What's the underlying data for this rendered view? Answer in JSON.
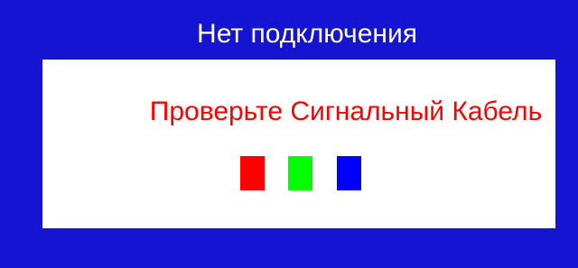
{
  "osd": {
    "title": "Нет подключения",
    "message": "Проверьте Сигнальный Кабель",
    "frame_color": "#1414d2",
    "message_color": "#ff0000",
    "color_test_blocks": [
      {
        "name": "red",
        "color": "#ff0000"
      },
      {
        "name": "green",
        "color": "#00ff00"
      },
      {
        "name": "blue",
        "color": "#0000ff"
      }
    ]
  }
}
